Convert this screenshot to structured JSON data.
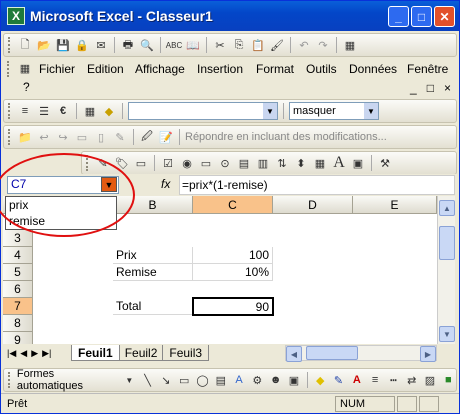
{
  "window": {
    "title": "Microsoft Excel - Classeur1",
    "app_icon_label": "X"
  },
  "toolbar_formatting": {
    "font_dropdown_value": "",
    "style_dropdown_value": "masquer",
    "reply_label": "Répondre en incluant des modifications..."
  },
  "menubar": {
    "items": [
      "Fichier",
      "Edition",
      "Affichage",
      "Insertion",
      "Format",
      "Outils",
      "Données",
      "Fenêtre"
    ],
    "help": "?",
    "controls": [
      "_",
      "□",
      "×"
    ]
  },
  "formula_bar": {
    "name_box": "C7",
    "fx_label": "fx",
    "formula": "=prix*(1-remise)"
  },
  "name_list": [
    "prix",
    "remise"
  ],
  "columns": [
    "B",
    "C",
    "D",
    "E"
  ],
  "rows": [
    "3",
    "4",
    "5",
    "6",
    "7",
    "8",
    "9"
  ],
  "cells": {
    "B4": "Prix",
    "C4": "100",
    "B5": "Remise",
    "C5": "10%",
    "B7": "Total",
    "C7": "90"
  },
  "sheets": [
    "Feuil1",
    "Feuil2",
    "Feuil3"
  ],
  "draw_toolbar": {
    "autoshapes_label": "Formes automatiques"
  },
  "status": {
    "ready": "Prêt",
    "num": "NUM"
  }
}
